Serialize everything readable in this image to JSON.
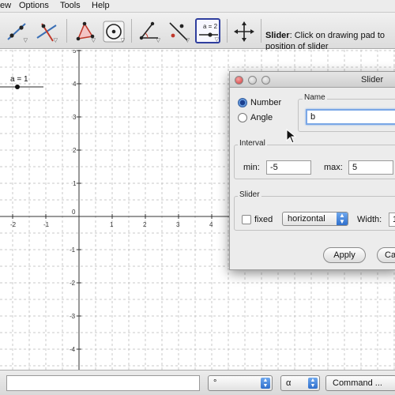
{
  "menu": {
    "items": [
      {
        "label": "ew"
      },
      {
        "label": "Options"
      },
      {
        "label": "Tools"
      },
      {
        "label": "Help"
      }
    ]
  },
  "toolbar": {
    "tools": [
      {
        "icon": "line-through-two-points-icon"
      },
      {
        "icon": "perpendicular-line-icon"
      },
      {
        "icon": "polygon-icon"
      },
      {
        "icon": "circle-with-center-icon"
      },
      {
        "icon": "angle-icon"
      },
      {
        "icon": "reflect-about-line-icon"
      },
      {
        "icon": "slider-icon",
        "selected": true,
        "caption": "a = 2"
      },
      {
        "icon": "move-graphics-view-icon"
      }
    ],
    "help_title": "Slider",
    "help_text": ": Click on drawing pad to",
    "help_text_line2": "position of slider"
  },
  "graphics": {
    "slider_label": "a = 1",
    "x_ticks": [
      "-2",
      "-1",
      "0",
      "1",
      "2",
      "3",
      "4"
    ],
    "y_ticks": [
      "5",
      "4",
      "3",
      "2",
      "1",
      "-1",
      "-2",
      "-3",
      "-4"
    ]
  },
  "dialog": {
    "title": "Slider",
    "type_options": [
      {
        "label": "Number",
        "selected": true
      },
      {
        "label": "Angle",
        "selected": false
      }
    ],
    "name_label": "Name",
    "name_value": "b",
    "interval_label": "Interval",
    "min_label": "min:",
    "min_value": "-5",
    "max_label": "max:",
    "max_value": "5",
    "slider_label": "Slider",
    "fixed_label": "fixed",
    "fixed_checked": false,
    "orientation_value": "horizontal",
    "width_label": "Width:",
    "width_value": "1",
    "apply_label": "Apply",
    "cancel_label": "Ca"
  },
  "inputbar": {
    "degree_symbol": "°",
    "alpha_symbol": "α",
    "command_label": "Command ..."
  },
  "colors": {
    "selected_tool_border": "#2f3e9e",
    "focus_ring": "#7aa7e6",
    "grid": "#c8c8c8"
  }
}
